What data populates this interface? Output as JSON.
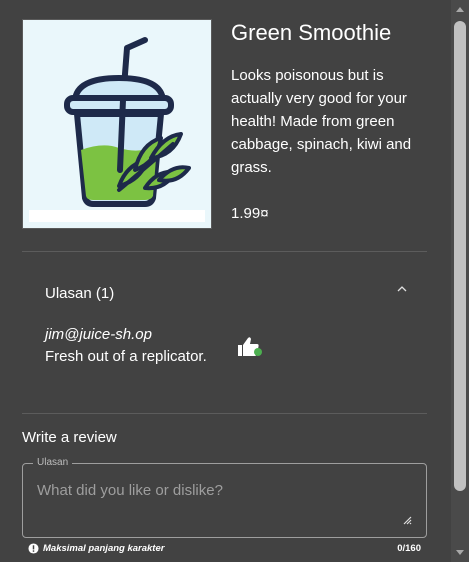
{
  "product": {
    "title": "Green Smoothie",
    "description": "Looks poisonous but is actually very good for your health! Made from green cabbage, spinach, kiwi and grass.",
    "price": "1.99¤",
    "image_icon": "smoothie-cup-icon"
  },
  "reviews": {
    "header": "Ulasan (1)",
    "expanded": true,
    "items": [
      {
        "author": "jim@juice-sh.op",
        "text": "Fresh out of a replicator.",
        "like_icon": "thumbs-up-icon"
      }
    ]
  },
  "write_review": {
    "label": "Write a review",
    "field_label": "Ulasan",
    "placeholder": "What did you like or dislike?",
    "hint": "Maksimal panjang karakter",
    "counter": "0/160"
  },
  "colors": {
    "background": "#424242",
    "smoothie_green": "#7cc242",
    "cup_outline": "#1e2a4a"
  }
}
